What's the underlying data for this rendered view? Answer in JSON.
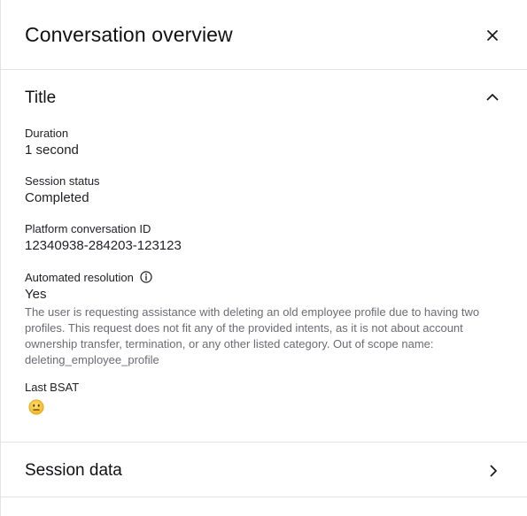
{
  "header": {
    "title": "Conversation overview",
    "close_icon": "close-icon"
  },
  "sections": {
    "title": {
      "heading": "Title",
      "expanded": true,
      "chevron_icon": "chevron-up-icon",
      "fields": {
        "duration": {
          "label": "Duration",
          "value": "1 second"
        },
        "session_status": {
          "label": "Session status",
          "value": "Completed"
        },
        "platform_conversation_id": {
          "label": "Platform conversation ID",
          "value": "12340938-284203-123123"
        },
        "automated_resolution": {
          "label": "Automated resolution",
          "info_icon": "info-icon",
          "value": "Yes",
          "description_lines": [
            "The user is requesting assistance with deleting an old employee profile due to having two",
            "profiles. This request does not fit any of the provided intents, as it is not about account",
            "ownership transfer, termination, or any other listed category.  Out of scope name:",
            "deleting_employee_profile"
          ]
        },
        "last_bsat": {
          "label": "Last BSAT",
          "value_icon": "neutral-face-emoji-icon"
        }
      }
    },
    "session_data": {
      "heading": "Session data",
      "expanded": false,
      "chevron_icon": "chevron-right-icon"
    }
  },
  "colors": {
    "text_primary": "#111114",
    "text_secondary": "#6b6b73",
    "divider": "#e4e4e7",
    "emoji_face": "#f5c431"
  }
}
